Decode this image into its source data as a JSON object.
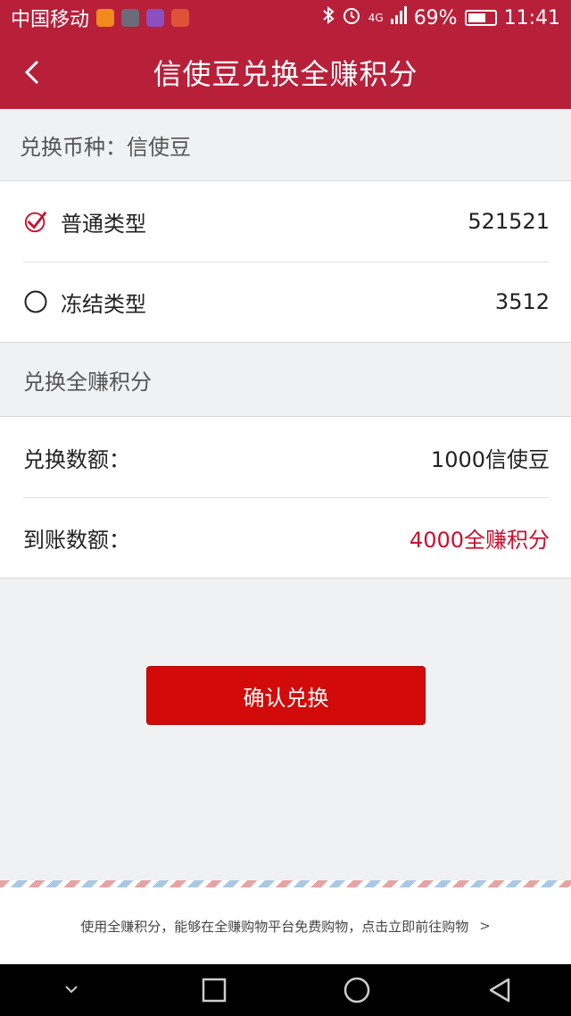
{
  "status_bar": {
    "carrier": "中国移动",
    "network": "4G",
    "battery": "69%",
    "time": "11:41",
    "battery_level": 0.69
  },
  "header": {
    "title": "信使豆兑换全赚积分"
  },
  "currency": {
    "text": "兑换币种：信使豆"
  },
  "types": [
    {
      "label": "普通类型",
      "value": "521521",
      "selected": true
    },
    {
      "label": "冻结类型",
      "value": "3512",
      "selected": false
    }
  ],
  "exchange_section": {
    "title": "兑换全赚积分",
    "amount_label": "兑换数额：",
    "amount_value": "1000信使豆",
    "received_label": "到账数额：",
    "received_value": "4000全赚积分"
  },
  "confirm_button": {
    "label": "确认兑换"
  },
  "footer": {
    "text": "使用全赚积分，能够在全赚购物平台免费购物，点击立即前往购物",
    "chevron": ">"
  },
  "colors": {
    "brand": "#b8203a",
    "accent": "#d20a0a",
    "highlight_text": "#c8102e"
  }
}
